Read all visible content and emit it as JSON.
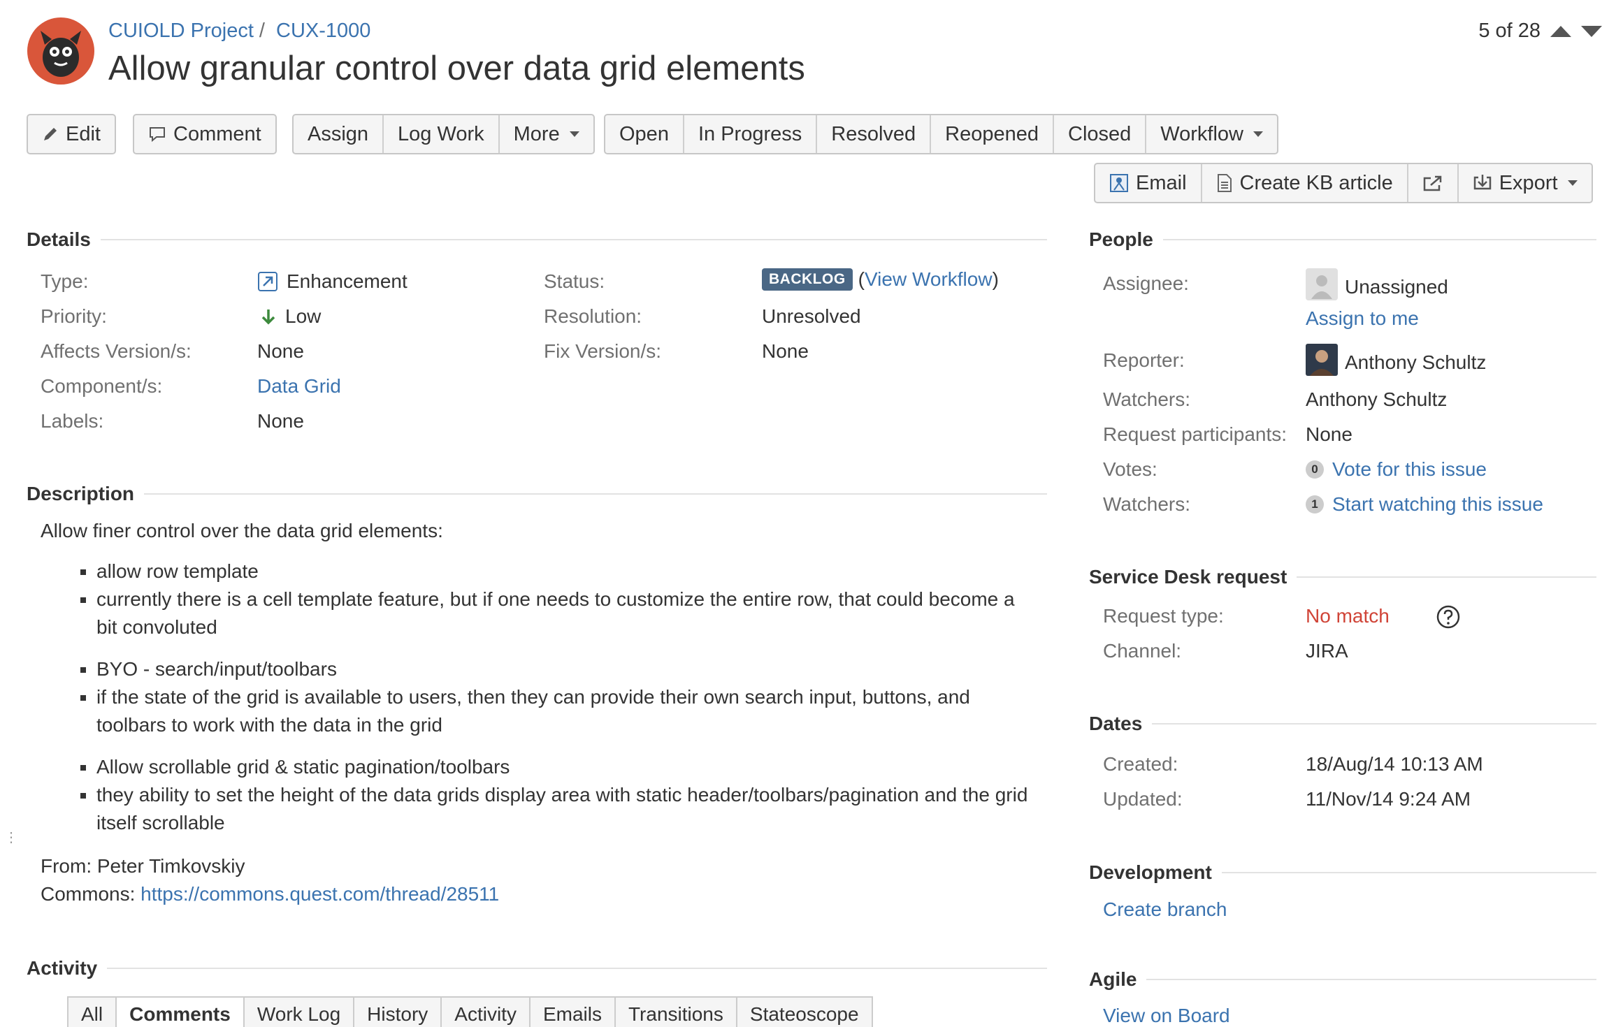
{
  "header": {
    "project": "CUIOLD Project",
    "separator": "/",
    "issue_key": "CUX-1000",
    "title": "Allow granular control over data grid elements",
    "pager": "5 of 28"
  },
  "toolbar": {
    "edit": "Edit",
    "comment": "Comment",
    "assign": "Assign",
    "log_work": "Log Work",
    "more": "More",
    "workflow_buttons": [
      "Open",
      "In Progress",
      "Resolved",
      "Reopened",
      "Closed"
    ],
    "workflow": "Workflow",
    "email": "Email",
    "create_kb": "Create KB article",
    "export": "Export"
  },
  "details": {
    "heading": "Details",
    "type_label": "Type:",
    "type_value": "Enhancement",
    "priority_label": "Priority:",
    "priority_value": "Low",
    "affects_label": "Affects Version/s:",
    "affects_value": "None",
    "component_label": "Component/s:",
    "component_value": "Data Grid",
    "labels_label": "Labels:",
    "labels_value": "None",
    "status_label": "Status:",
    "status_value": "BACKLOG",
    "view_workflow_open": "(",
    "view_workflow": "View Workflow",
    "view_workflow_close": ")",
    "resolution_label": "Resolution:",
    "resolution_value": "Unresolved",
    "fix_label": "Fix Version/s:",
    "fix_value": "None"
  },
  "description": {
    "heading": "Description",
    "intro": "Allow finer control over the data grid elements:",
    "groups": [
      [
        "allow row template",
        "currently there is a cell template feature, but if one needs to customize the entire row, that could become a bit convoluted"
      ],
      [
        "BYO - search/input/toolbars",
        "if the state of the grid is available to users, then they can provide their own search input, buttons, and toolbars to work with the data in the grid"
      ],
      [
        "Allow scrollable grid & static pagination/toolbars",
        "they ability to set the height of the data grids display area with static header/toolbars/pagination and the grid itself scrollable"
      ]
    ],
    "from": "From: Peter Timkovskiy",
    "commons_label": "Commons: ",
    "commons_link": "https://commons.quest.com/thread/28511"
  },
  "activity": {
    "heading": "Activity",
    "tabs": [
      "All",
      "Comments",
      "Work Log",
      "History",
      "Activity",
      "Emails",
      "Transitions",
      "Stateoscope"
    ],
    "active_tab": "Comments"
  },
  "people": {
    "heading": "People",
    "assignee_label": "Assignee:",
    "assignee_value": "Unassigned",
    "assign_to_me": "Assign to me",
    "reporter_label": "Reporter:",
    "reporter_value": "Anthony Schultz",
    "watchers_label": "Watchers:",
    "watchers_value": "Anthony Schultz",
    "participants_label": "Request participants:",
    "participants_value": "None",
    "votes_label": "Votes:",
    "votes_count": "0",
    "vote_link": "Vote for this issue",
    "watchers2_label": "Watchers:",
    "watch_count": "1",
    "watch_link": "Start watching this issue"
  },
  "service_desk": {
    "heading": "Service Desk request",
    "request_type_label": "Request type:",
    "request_type_value": "No match",
    "channel_label": "Channel:",
    "channel_value": "JIRA"
  },
  "dates": {
    "heading": "Dates",
    "created_label": "Created:",
    "created_value": "18/Aug/14 10:13 AM",
    "updated_label": "Updated:",
    "updated_value": "11/Nov/14 9:24 AM"
  },
  "development": {
    "heading": "Development",
    "create_branch": "Create branch"
  },
  "agile": {
    "heading": "Agile",
    "view_on_board": "View on Board"
  },
  "colors": {
    "link": "#3b73af",
    "lozenge": "#4a6785",
    "no_match": "#d04437",
    "priority_low": "#3d8a3d"
  }
}
